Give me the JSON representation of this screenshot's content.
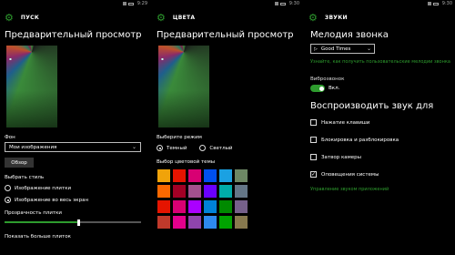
{
  "panel_start": {
    "status": {
      "time": "9:29"
    },
    "header_title": "ПУСК",
    "preview_heading": "Предварительный просмотр",
    "background_label": "Фон",
    "background_value": "Мои изображения",
    "browse_label": "Обзор",
    "style_label": "Выбрать стиль",
    "style_options": [
      "Изображение плитки",
      "Изображение во весь экран"
    ],
    "style_selected_index": 1,
    "transparency_label": "Прозрачность плитки",
    "transparency_level_percent": 53,
    "more_tiles_label": "Показать больше плиток"
  },
  "panel_colors": {
    "status": {
      "time": "9:30"
    },
    "header_title": "ЦВЕТА",
    "preview_heading": "Предварительный просмотр",
    "mode_label": "Выберите режим",
    "mode_options": [
      "Темный",
      "Светлый"
    ],
    "mode_selected_index": 0,
    "theme_label": "Выбор цветовой темы",
    "swatches": [
      "#f0a30a",
      "#e51400",
      "#d80073",
      "#0050ef",
      "#1ba1e2",
      "#6d8764",
      "#fa6800",
      "#a20025",
      "#a4508e",
      "#6a00ff",
      "#00aba9",
      "#647687",
      "#e51400",
      "#d80073",
      "#aa00ff",
      "#0082d8",
      "#008a00",
      "#76608a",
      "#c0392b",
      "#e3008c",
      "#8e44ad",
      "#2d89ef",
      "#00a300",
      "#87794e"
    ]
  },
  "panel_sounds": {
    "status": {
      "time": "9:30"
    },
    "header_title": "ЗВУКИ",
    "ringtone_heading": "Мелодия звонка",
    "ringtone_value": "Good Times",
    "ringtone_link": "Узнайте, как получить пользовательские мелодии звонка",
    "vibrate_label": "Виброзвонок",
    "vibrate_state": "Вкл.",
    "play_sound_heading": "Воспроизводить звук для",
    "sound_options": [
      {
        "label": "Нажатие клавиши",
        "checked": false
      },
      {
        "label": "Блокировка и разблокировка",
        "checked": false
      },
      {
        "label": "Затвор камеры",
        "checked": false
      },
      {
        "label": "Оповещения системы",
        "checked": true
      }
    ],
    "manage_link": "Управление звуком приложений"
  },
  "colors": {
    "accent": "#2e9c2e"
  }
}
